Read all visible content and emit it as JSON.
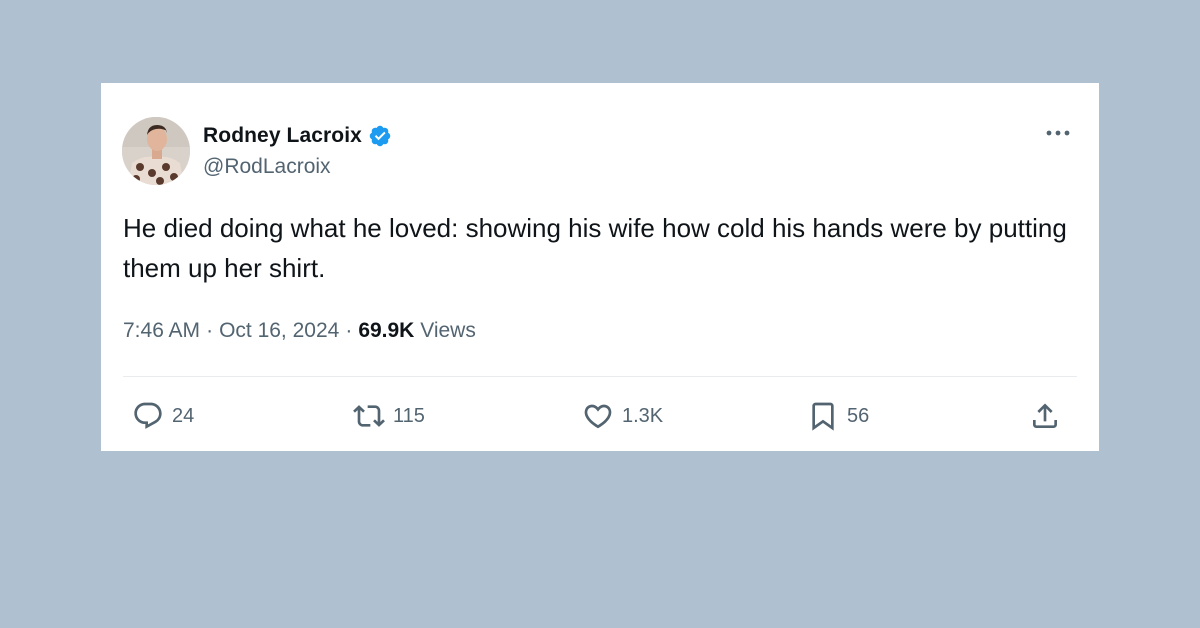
{
  "tweet": {
    "author": {
      "display_name": "Rodney Lacroix",
      "handle": "@RodLacroix",
      "verified": true
    },
    "text": "He died doing what he loved: showing his wife how cold his hands were by putting them up her shirt.",
    "time": "7:46 AM",
    "separator": "·",
    "date": "Oct 16, 2024",
    "views_count": "69.9K",
    "views_label": "Views"
  },
  "actions": {
    "replies": "24",
    "retweets": "115",
    "likes": "1.3K",
    "bookmarks": "56"
  },
  "icons": {
    "verified": "verified-badge-icon",
    "more": "more-horizontal-icon",
    "reply": "reply-bubble-icon",
    "retweet": "retweet-icon",
    "like": "heart-icon",
    "bookmark": "bookmark-icon",
    "share": "share-upload-icon"
  },
  "colors": {
    "background": "#afc1d1",
    "card": "#ffffff",
    "text_primary": "#0f1419",
    "text_secondary": "#536471",
    "verified_blue": "#1d9bf0"
  }
}
